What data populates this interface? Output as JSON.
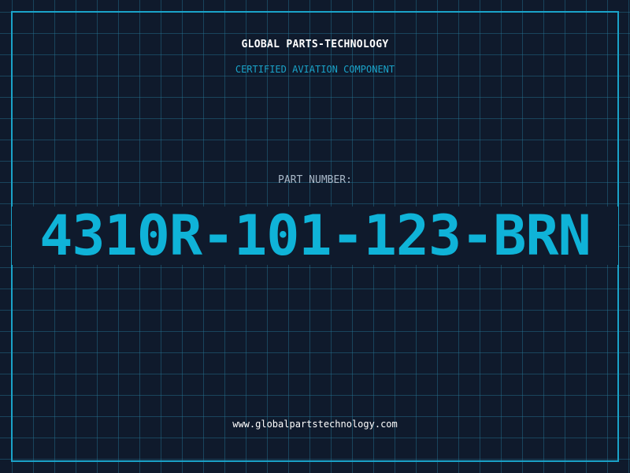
{
  "brand": {
    "name": "GLOBAL PARTS-TECHNOLOGY",
    "tagline": "CERTIFIED AVIATION COMPONENT"
  },
  "part": {
    "label": "PART NUMBER:",
    "number": "4310R-101-123-BRN"
  },
  "footer": {
    "url": "www.globalpartstechnology.com"
  },
  "colors": {
    "background": "#0f1a2c",
    "grid": "#267896",
    "accent": "#1aa3c9",
    "part_number": "#0fb3d8",
    "label": "#a9b8c8",
    "text": "#ffffff"
  }
}
